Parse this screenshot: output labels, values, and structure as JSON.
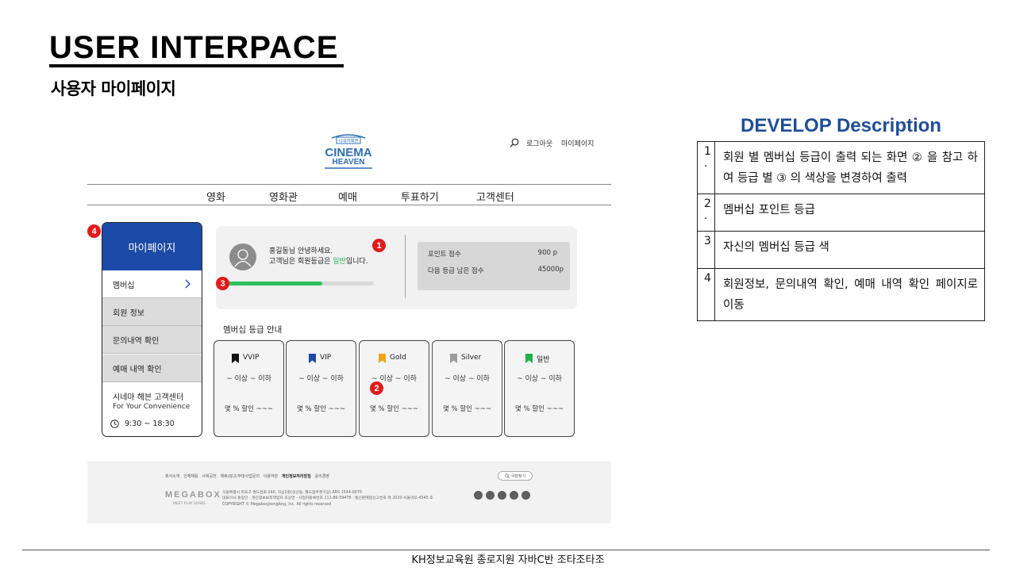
{
  "slide": {
    "title": "USER INTERPACE",
    "subtitle": "사용자 마이페이지",
    "bottom_text": "KH정보교육원 종로지원 자바C반 조타조타조"
  },
  "header": {
    "logo_small": "시네마헤븐",
    "logo_line1": "CINEMA",
    "logo_line2": "HEAVEN",
    "logout": "로그아웃",
    "mypage": "마이페이지",
    "logo_color": "#2b6fb8"
  },
  "nav": {
    "items": [
      "영화",
      "영화관",
      "예매",
      "투표하기",
      "고객센터"
    ]
  },
  "sidebar": {
    "head": "마이페이지",
    "items": [
      "멤버십",
      "회원 정보",
      "문의내역 확인",
      "예매 내역 확인"
    ],
    "cs_title": "시네마 헤븐 고객센터",
    "cs_sub": "For Your Convenience",
    "hours": "9:30 ~ 18:30",
    "accent": "#1c4aa8"
  },
  "profile": {
    "greeting": "홍길동님 안녕하세요.",
    "grade_prefix": "고객님은 회원등급은 ",
    "grade": "일반",
    "grade_suffix": "입니다.",
    "progress": 0.66,
    "progress_color": "#2ec05a",
    "point_label": "포인트 점수",
    "point_value": "900 p",
    "next_label": "다음 등급 남은 점수",
    "next_value": "45000p"
  },
  "grades": {
    "title": "멤버십 등급 안내",
    "cards": [
      {
        "name": "VVIP",
        "color": "#111111",
        "range": "~ 이상 ~ 이하",
        "discount": "몇 % 할인 ~~~"
      },
      {
        "name": "VIP",
        "color": "#1c4aa8",
        "range": "~ 이상 ~ 이하",
        "discount": "몇 % 할인 ~~~"
      },
      {
        "name": "Gold",
        "color": "#f0a31c",
        "range": "~ 이상 ~ 이하",
        "discount": "몇 % 할인 ~~~"
      },
      {
        "name": "Silver",
        "color": "#9b9b9b",
        "range": "~ 이상 ~ 이하",
        "discount": "몇 % 할인 ~~~"
      },
      {
        "name": "일반",
        "color": "#22b24c",
        "range": "~ 이상 ~ 이하",
        "discount": "몇 % 할인 ~~~"
      }
    ]
  },
  "markers": [
    "1",
    "2",
    "3",
    "4"
  ],
  "footer": {
    "links": [
      "회사소개",
      "인재채용",
      "사회공헌",
      "제휴/광고/부대사업문의",
      "이용약관"
    ],
    "privacy": "개인정보처리방침",
    "last_link": "윤리경영",
    "search": "극장찾기",
    "logo": "MEGABOX",
    "slogan": "MEET PLAY SHARE",
    "addr1": "서울특별시 마포구 월드컵로 240, 지상2층(성산동, 월드컵주경기장) ARS 1544-0070",
    "addr2": "대표이사 홍정인 · 개인정보보호책임자 조상연 · 사업자등록번호 211-86-59478 · 통신판매업신고번호 제 2020-서울마포-4545 호",
    "addr3": "COPYRIGHT © MegaboxJoongAng, Inc. All rights reserved"
  },
  "description": {
    "title": "DEVELOP Description",
    "rows": [
      {
        "num": "1\n.",
        "text": "회원 별 멤버십 등급이 출력 되는 화면 ② 을 참고 하여 등급 별 ③ 의 색상을 변경하여 출력"
      },
      {
        "num": "2\n.",
        "text": "멤버십 포인트 등급"
      },
      {
        "num": "3",
        "text": "자신의 멤버십 등급 색"
      },
      {
        "num": "4",
        "text": "회원정보, 문의내역 확인, 예매 내역 확인 페이지로 이동"
      }
    ]
  }
}
